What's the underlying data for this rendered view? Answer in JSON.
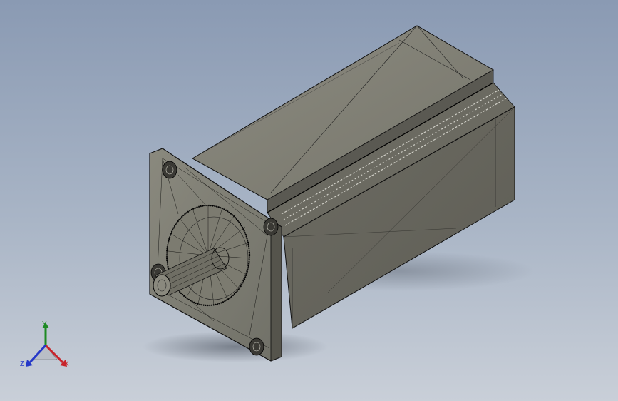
{
  "viewport": {
    "background_top": "#8a9ab3",
    "background_bottom": "#c9cfd8"
  },
  "model": {
    "name": "stepper-motor-wireframe",
    "shaded_color": "#807f74",
    "edge_color": "#000000"
  },
  "triad": {
    "y_label": "Y",
    "z_label": "Z",
    "x_label": "X",
    "y_color": "#1d8a23",
    "z_color": "#2538c8",
    "x_color": "#c8242b"
  }
}
